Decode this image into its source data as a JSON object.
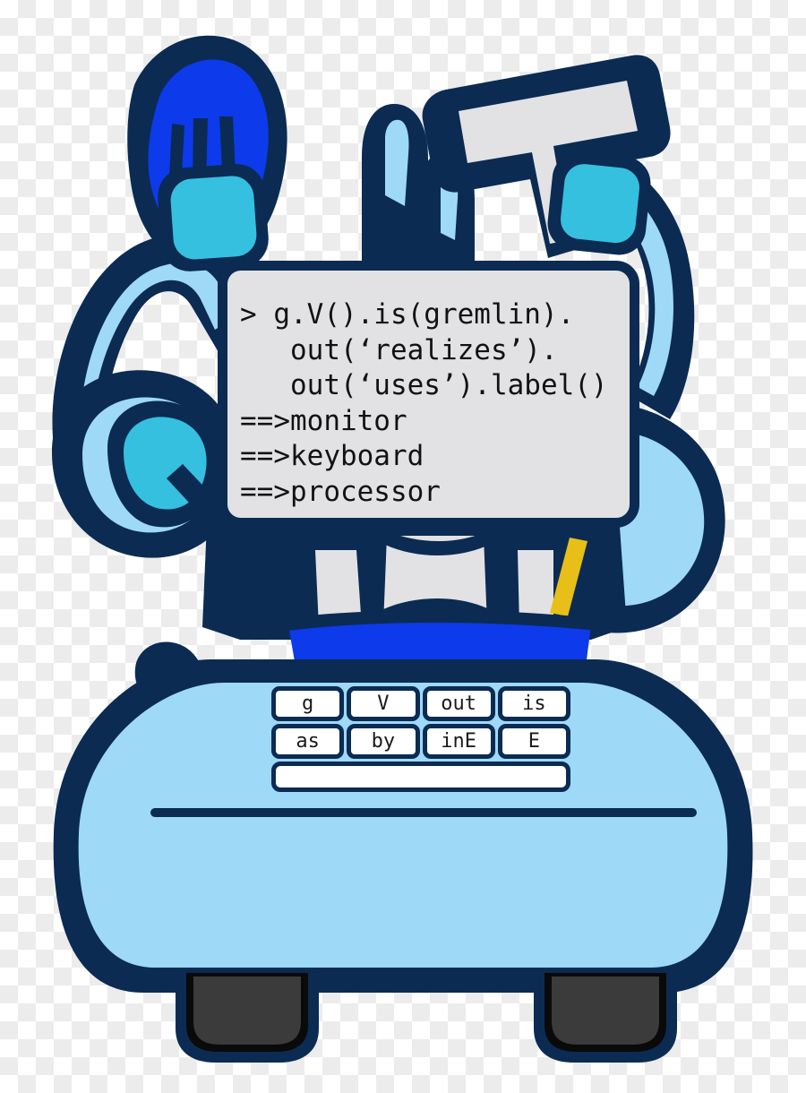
{
  "scene": {
    "title": "Gremlin robot mascot at a terminal",
    "background": "transparency-checkerboard"
  },
  "console": {
    "name": "gremlin-console",
    "lines": [
      "> g.V().is(gremlin).",
      "   out(‘realizes’).",
      "   out(‘uses’).label()",
      "==>monitor",
      "==>keyboard",
      "==>processor"
    ]
  },
  "keyboard": {
    "rows": [
      [
        {
          "label": "g"
        },
        {
          "label": "V"
        },
        {
          "label": "out"
        },
        {
          "label": "is"
        }
      ],
      [
        {
          "label": "as"
        },
        {
          "label": "by"
        },
        {
          "label": "inE"
        },
        {
          "label": "E"
        }
      ]
    ],
    "spacebar": {
      "label": ""
    }
  },
  "colors": {
    "outline_navy": "#0b2b53",
    "body_light_blue": "#9ed9f8",
    "accent_cyan": "#35c0e0",
    "accent_bright_blue": "#0d3aea",
    "panel_gray": "#e2e2e4",
    "foot_dark": "#3b3b3b",
    "foot_black": "#0a0a0a",
    "gold": "#e8be18",
    "checker_light": "#ffffff",
    "checker_gray": "#ececec"
  }
}
